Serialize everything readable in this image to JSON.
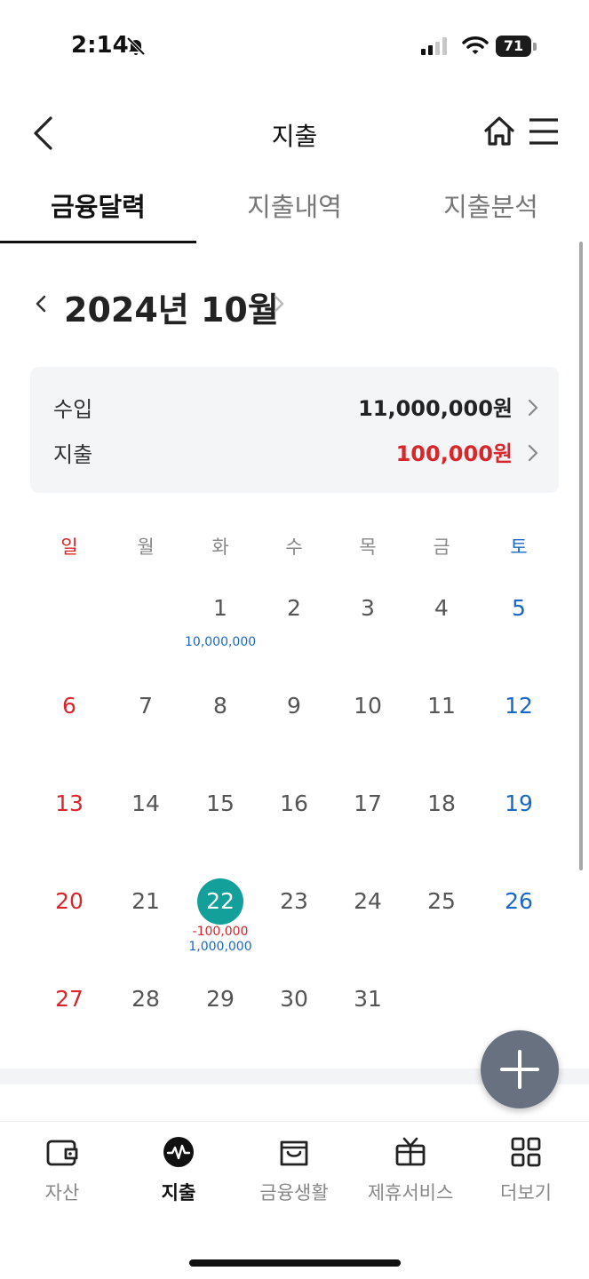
{
  "status_bar": {
    "time": "2:14",
    "battery": "71"
  },
  "header": {
    "title": "지출"
  },
  "tabs": [
    {
      "label": "금융달력",
      "active": true
    },
    {
      "label": "지출내역",
      "active": false
    },
    {
      "label": "지출분석",
      "active": false
    }
  ],
  "calendar": {
    "month_label": "2024년 10월",
    "summary": {
      "income_label": "수입",
      "income_value": "11,000,000원",
      "expense_label": "지출",
      "expense_value": "100,000원"
    },
    "weekdays": [
      "일",
      "월",
      "화",
      "수",
      "목",
      "금",
      "토"
    ],
    "today": 22,
    "days": [
      {
        "day": 1,
        "income": "10,000,000"
      },
      {
        "day": 2
      },
      {
        "day": 3
      },
      {
        "day": 4
      },
      {
        "day": 5
      },
      {
        "day": 6
      },
      {
        "day": 7
      },
      {
        "day": 8
      },
      {
        "day": 9
      },
      {
        "day": 10
      },
      {
        "day": 11
      },
      {
        "day": 12
      },
      {
        "day": 13
      },
      {
        "day": 14
      },
      {
        "day": 15
      },
      {
        "day": 16
      },
      {
        "day": 17
      },
      {
        "day": 18
      },
      {
        "day": 19
      },
      {
        "day": 20
      },
      {
        "day": 21
      },
      {
        "day": 22,
        "expense": "-100,000",
        "income": "1,000,000"
      },
      {
        "day": 23
      },
      {
        "day": 24
      },
      {
        "day": 25
      },
      {
        "day": 26
      },
      {
        "day": 27
      },
      {
        "day": 28
      },
      {
        "day": 29
      },
      {
        "day": 30
      },
      {
        "day": 31
      }
    ],
    "first_weekday": 2
  },
  "bottom_nav": [
    {
      "label": "자산",
      "icon": "wallet-icon",
      "active": false
    },
    {
      "label": "지출",
      "icon": "pulse-icon",
      "active": true
    },
    {
      "label": "금융생활",
      "icon": "shopping-bag-icon",
      "active": false
    },
    {
      "label": "제휴서비스",
      "icon": "gift-icon",
      "active": false
    },
    {
      "label": "더보기",
      "icon": "grid-icon",
      "active": false
    }
  ],
  "colors": {
    "expense_red": "#d9262b",
    "income_blue": "#1a68c5",
    "today_teal": "#13a09a",
    "fab_gray": "#68717f"
  }
}
